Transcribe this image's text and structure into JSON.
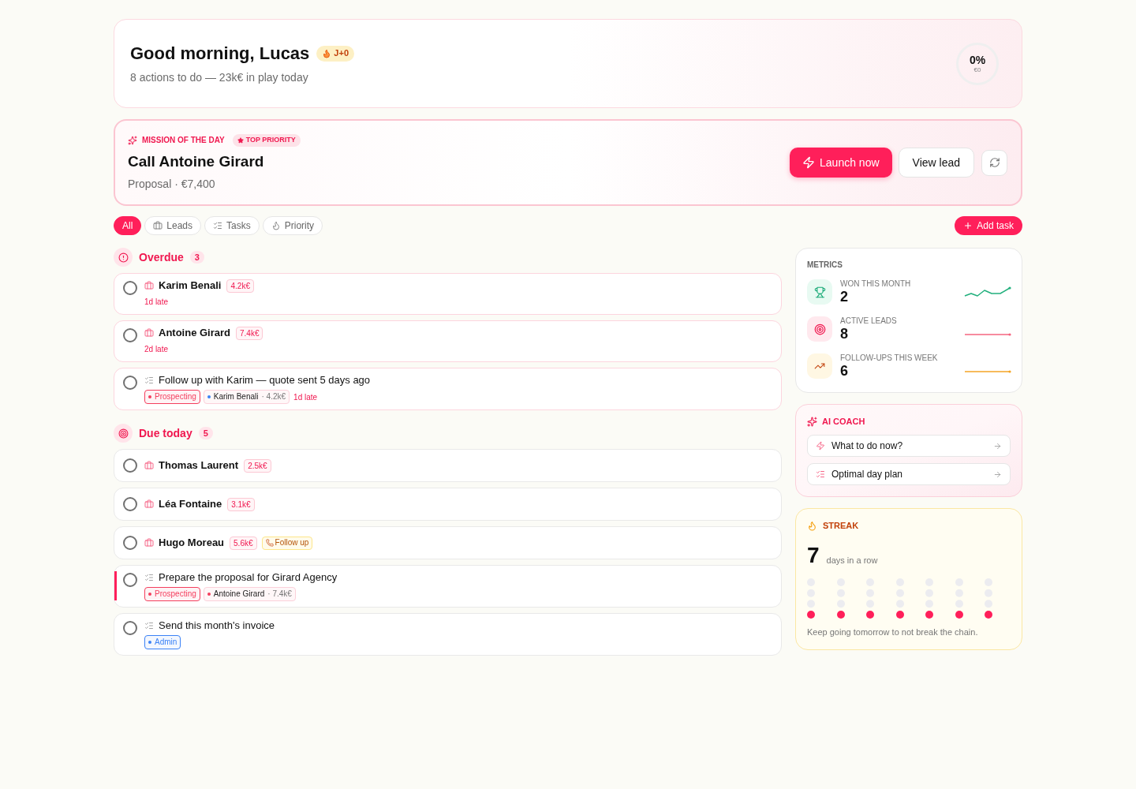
{
  "header": {
    "greeting": "Good morning, Lucas",
    "streak_badge": "J+0",
    "summary": "8 actions to do — 23k€ in play today",
    "progress": {
      "percent": "0%",
      "amount": "€0"
    }
  },
  "mission": {
    "label": "MISSION OF THE DAY",
    "priority": "TOP PRIORITY",
    "title": "Call Antoine Girard",
    "detail": "Proposal · €7,400",
    "buttons": [
      {
        "label": "Launch now",
        "kind": "primary"
      },
      {
        "label": "View lead",
        "kind": "secondary"
      }
    ]
  },
  "filters": [
    {
      "label": "All",
      "kind": "all",
      "selected": true
    },
    {
      "label": "Leads",
      "kind": "leads",
      "selected": false
    },
    {
      "label": "Tasks",
      "kind": "tasks",
      "selected": false
    },
    {
      "label": "Priority",
      "kind": "priority",
      "selected": false
    }
  ],
  "add_task": "Add task",
  "sections": [
    {
      "kind": "overdue",
      "title": "Overdue",
      "count": "3",
      "items": [
        {
          "kind": "lead",
          "checked": false,
          "highlighted": false,
          "name": "Karim Benali",
          "amount": "4.2k€",
          "late": "1d late"
        },
        {
          "kind": "lead",
          "checked": false,
          "highlighted": false,
          "name": "Antoine Girard",
          "amount": "7.4k€",
          "late": "2d late"
        },
        {
          "kind": "task",
          "checked": false,
          "highlighted": false,
          "title": "Follow up with Karim — quote sent 5 days ago",
          "tags": [
            {
              "kind": "stage",
              "label": "Prospecting",
              "color": "#f43f5e"
            },
            {
              "kind": "lead",
              "label": "Karim Benali",
              "detail": "· 4.2k€",
              "color": "#3b82f6"
            }
          ],
          "late": "1d late"
        }
      ]
    },
    {
      "kind": "today",
      "title": "Due today",
      "count": "5",
      "items": [
        {
          "kind": "lead",
          "checked": false,
          "highlighted": false,
          "name": "Thomas Laurent",
          "amount": "2.5k€"
        },
        {
          "kind": "lead",
          "checked": false,
          "highlighted": false,
          "name": "Léa Fontaine",
          "amount": "3.1k€"
        },
        {
          "kind": "lead",
          "checked": false,
          "highlighted": false,
          "name": "Hugo Moreau",
          "amount": "5.6k€",
          "action": "Follow up"
        },
        {
          "kind": "task",
          "checked": false,
          "highlighted": true,
          "title": "Prepare the proposal for Girard Agency",
          "tags": [
            {
              "kind": "stage",
              "label": "Prospecting",
              "color": "#f43f5e"
            },
            {
              "kind": "lead",
              "label": "Antoine Girard",
              "detail": "· 7.4k€",
              "color": "#f43f5e"
            }
          ]
        },
        {
          "kind": "task",
          "checked": false,
          "highlighted": false,
          "title": "Send this month's invoice",
          "tags": [
            {
              "kind": "stage",
              "label": "Admin",
              "color": "#3b82f6"
            }
          ]
        }
      ]
    }
  ],
  "metrics": {
    "title": "METRICS",
    "items": [
      {
        "kind": "won",
        "label": "WON THIS MONTH",
        "value": "2"
      },
      {
        "kind": "leads",
        "label": "ACTIVE LEADS",
        "value": "8"
      },
      {
        "kind": "followups",
        "label": "FOLLOW-UPS THIS WEEK",
        "value": "6"
      }
    ]
  },
  "coach": {
    "title": "AI COACH",
    "actions": [
      {
        "kind": "now",
        "label": "What to do now?"
      },
      {
        "kind": "plan",
        "label": "Optimal day plan"
      }
    ]
  },
  "streak": {
    "title": "STREAK",
    "count": "7",
    "unit": "days in a row",
    "days": [
      {
        "level": 0.25
      },
      {
        "level": 0.25
      },
      {
        "level": 0.25
      },
      {
        "level": 0.25
      },
      {
        "level": 0.25
      },
      {
        "level": 0.25
      },
      {
        "level": 0.25
      }
    ],
    "note": "Keep going tomorrow to not break the chain."
  }
}
